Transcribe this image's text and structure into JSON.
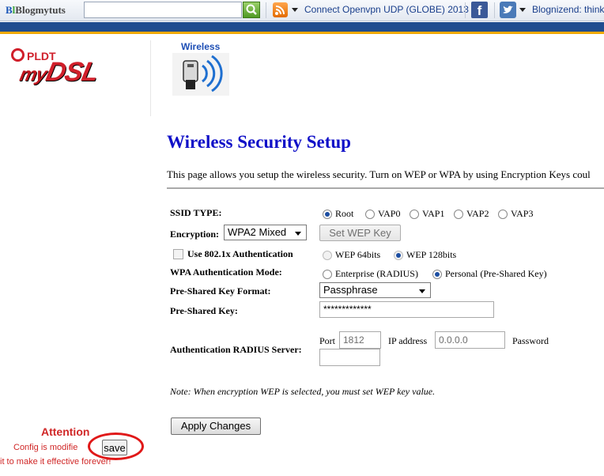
{
  "toolbar": {
    "logo": "Blogmytuts",
    "link1": "Connect Openvpn UDP (GLOBE) 2013",
    "link2": "Blognizend: think"
  },
  "header": {
    "brand_top": "PLDT",
    "brand_my": "my",
    "brand_dsl": "DSL",
    "nav_label": "Wireless"
  },
  "page": {
    "title": "Wireless Security Setup",
    "description": "This page allows you setup the wireless security. Turn on WEP or WPA by using Encryption Keys coul"
  },
  "form": {
    "ssid_label": "SSID TYPE:",
    "ssid_options": [
      "Root",
      "VAP0",
      "VAP1",
      "VAP2",
      "VAP3"
    ],
    "encryption_label": "Encryption:",
    "encryption_value": "WPA2 Mixed",
    "set_wep_key": "Set WEP Key",
    "use_8021x": "Use 802.1x Authentication",
    "wep_64": "WEP 64bits",
    "wep_128": "WEP 128bits",
    "wpa_auth_label": "WPA Authentication Mode:",
    "enterprise": "Enterprise (RADIUS)",
    "personal": "Personal (Pre-Shared Key)",
    "psk_format_label": "Pre-Shared Key Format:",
    "psk_format_value": "Passphrase",
    "psk_label": "Pre-Shared Key:",
    "psk_value": "*************",
    "radius_label": "Authentication RADIUS Server:",
    "port_label": "Port",
    "port_value": "1812",
    "ip_label": "IP address",
    "ip_value": "0.0.0.0",
    "password_label": "Password",
    "note": "Note: When encryption WEP is selected, you must set WEP key value.",
    "apply": "Apply Changes"
  },
  "attention": {
    "title": "Attention",
    "line1": "Config is modifie",
    "line2": "it to make it effective forever!",
    "save": "save"
  },
  "colors": {
    "title_blue": "#1010c8",
    "header_blue": "#1f4c8f",
    "header_orange": "#f2a900",
    "attention_red": "#d02727"
  }
}
